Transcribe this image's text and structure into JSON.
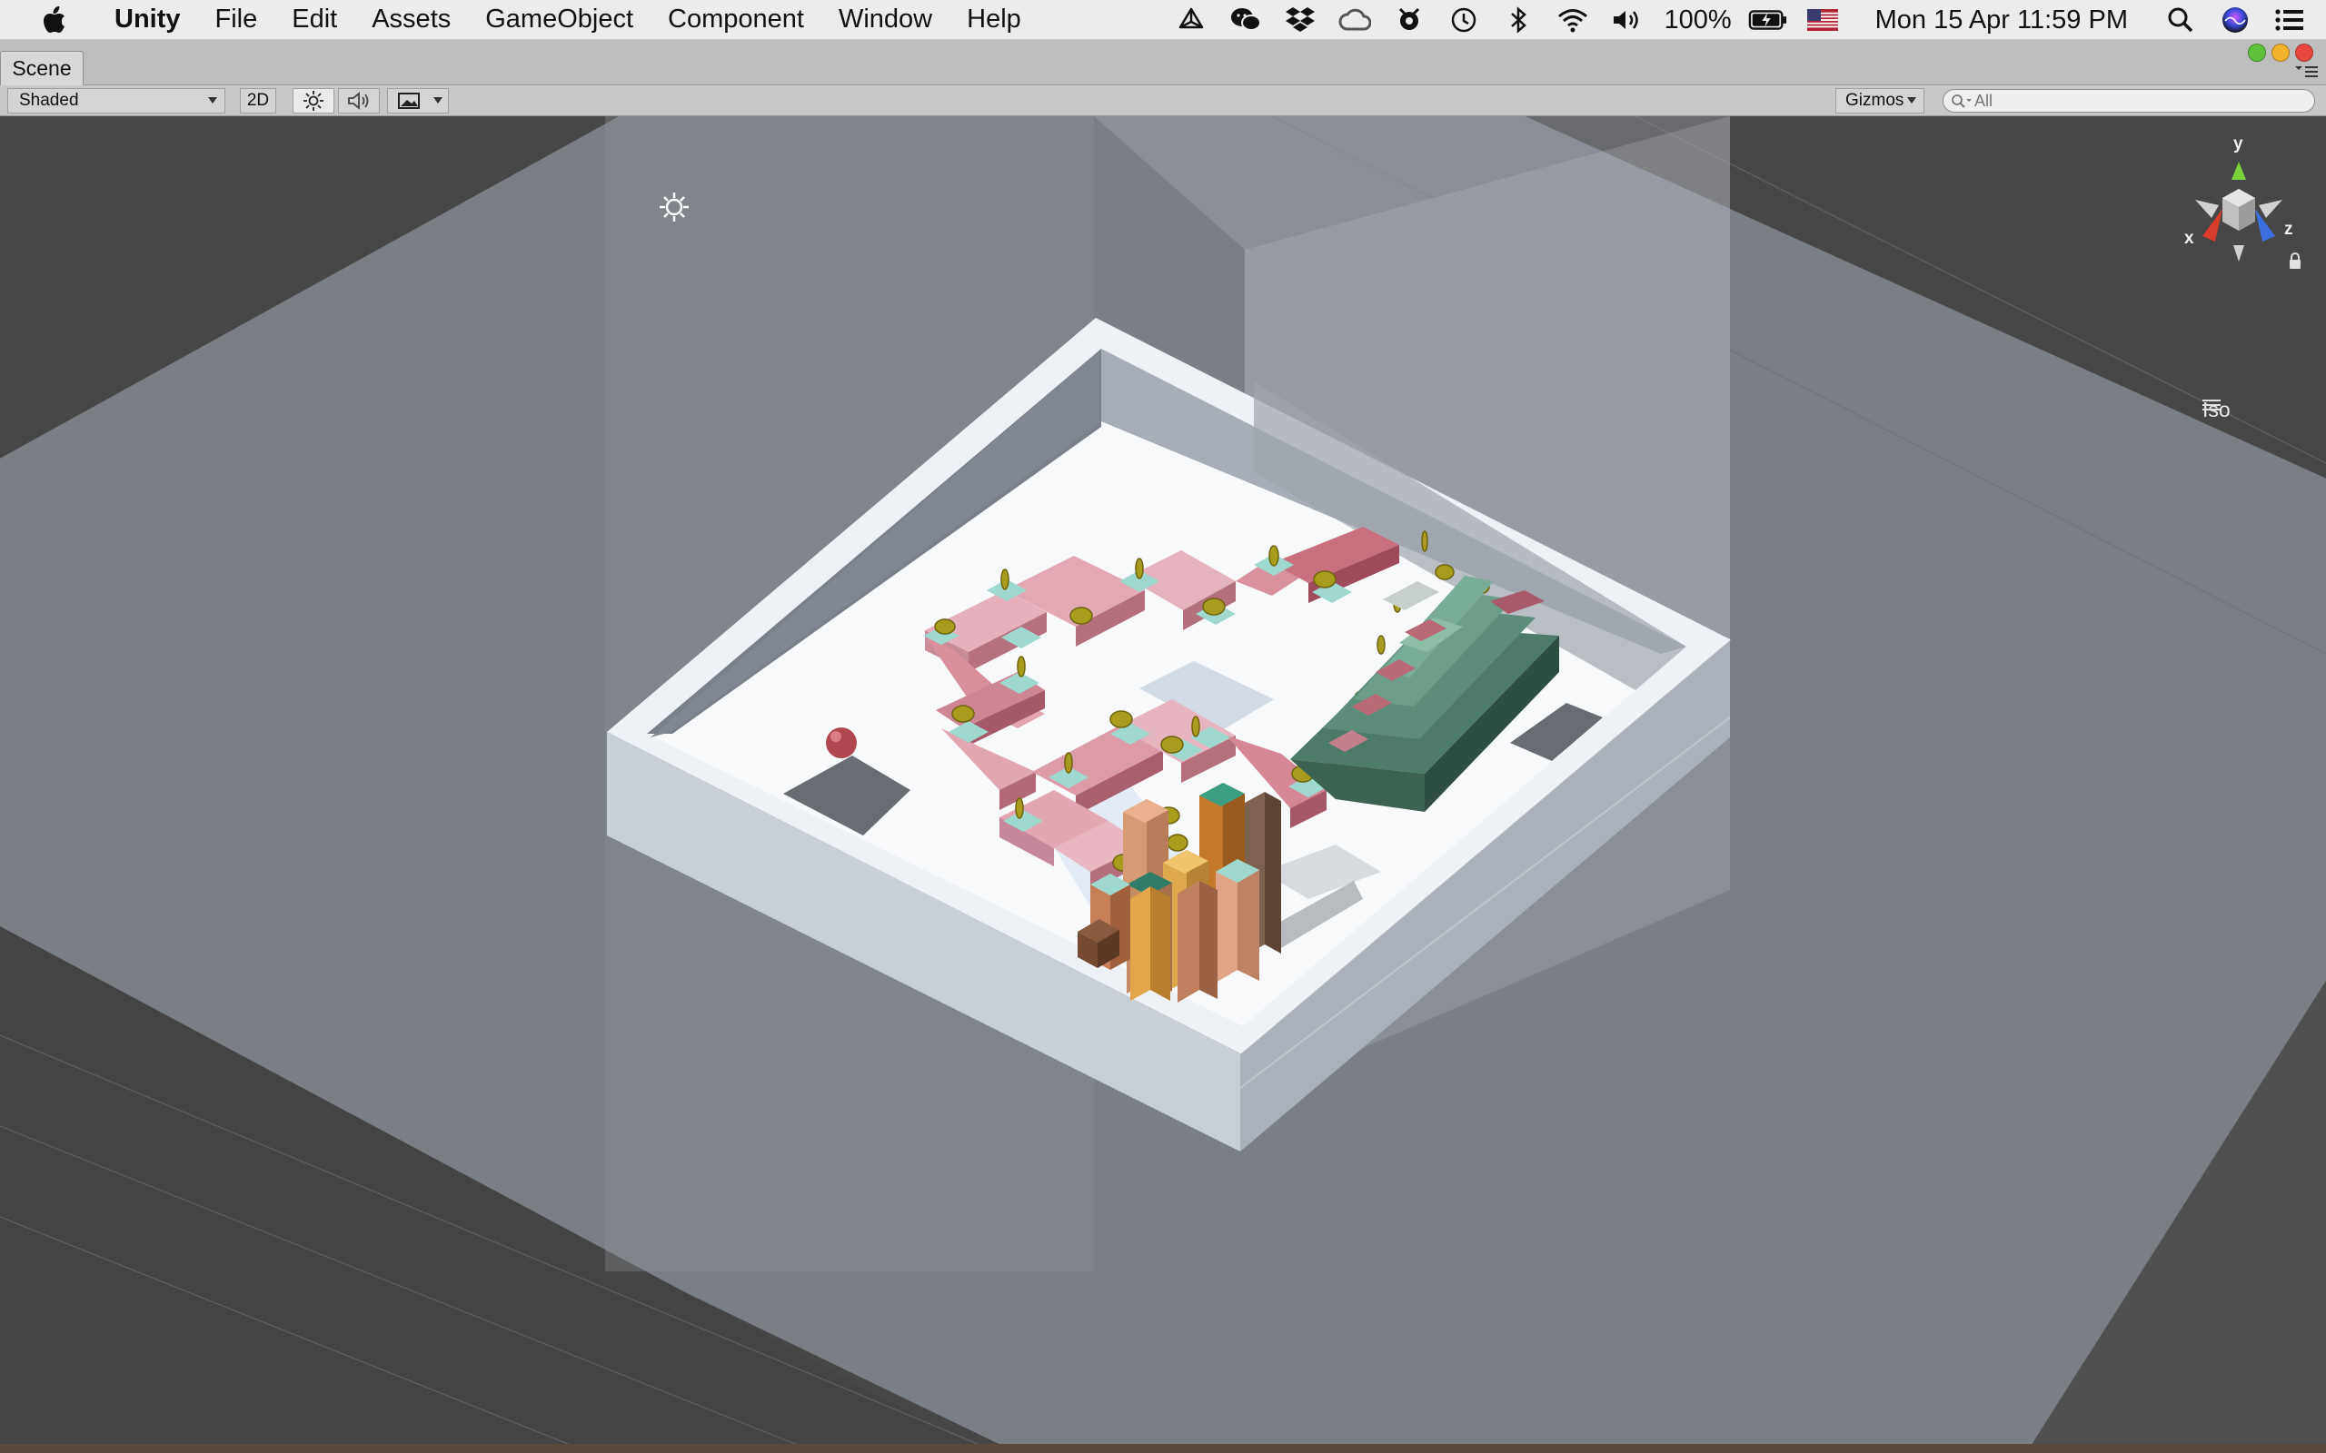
{
  "menubar": {
    "app_name": "Unity",
    "items": [
      "File",
      "Edit",
      "Assets",
      "GameObject",
      "Component",
      "Window",
      "Help"
    ],
    "battery": "100%",
    "datetime": "Mon 15 Apr  11:59 PM",
    "tray_icons": [
      "unity-hub-icon",
      "wechat-icon",
      "dropbox-icon",
      "creative-cloud-icon",
      "app-icon",
      "time-machine-icon",
      "bluetooth-icon",
      "wifi-icon",
      "volume-icon",
      "battery-icon",
      "flag-icon",
      "spotlight-icon",
      "siri-icon",
      "notification-center-icon"
    ]
  },
  "scene_tab": {
    "label": "Scene"
  },
  "toolbar": {
    "draw_mode": "Shaded",
    "mode_2d": "2D",
    "gizmos": "Gizmos",
    "search_placeholder": "All"
  },
  "scene_gizmo": {
    "projection": "Iso",
    "axes": {
      "x": "x",
      "y": "y",
      "z": "z"
    }
  },
  "colors": {
    "menubar_bg": "#ececec",
    "toolbar_bg": "#c8c8c8",
    "viewport_bg": "#474747",
    "axis_x": "#d93b2b",
    "axis_y": "#7bd23a",
    "axis_z": "#3b6fe0"
  }
}
